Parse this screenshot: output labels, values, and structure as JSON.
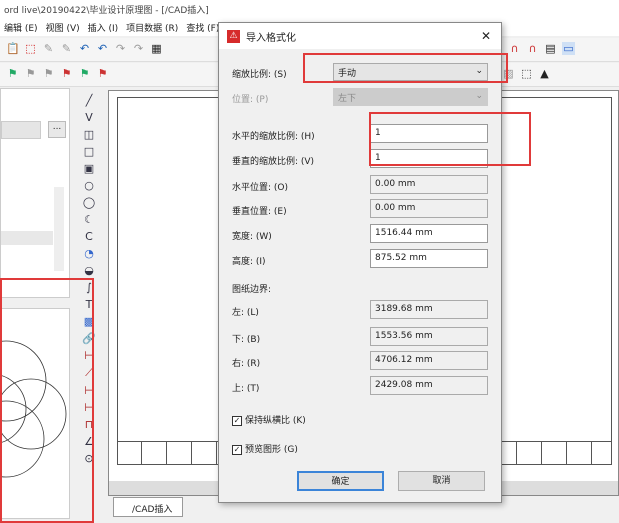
{
  "window": {
    "title": "ord live\\20190422\\毕业设计原理图 - [/CAD插入]"
  },
  "menu": [
    "编辑 (E)",
    "视图 (V)",
    "插入 (I)",
    "项目数据 (R)",
    "查找 (F)"
  ],
  "tab": {
    "label": "/CAD插入"
  },
  "dialog": {
    "title": "导入格式化",
    "close": "✕",
    "scale_label": "缩放比例: (S)",
    "scale_value": "手动",
    "position_label": "位置: (P)",
    "position_value": "左下",
    "hscale_label": "水平的缩放比例: (H)",
    "hscale_value": "1",
    "vscale_label": "垂直的缩放比例: (V)",
    "vscale_value": "1",
    "hpos_label": "水平位置: (O)",
    "hpos_value": "0.00 mm",
    "vpos_label": "垂直位置: (E)",
    "vpos_value": "0.00 mm",
    "width_label": "宽度: (W)",
    "width_value": "1516.44 mm",
    "height_label": "高度: (I)",
    "height_value": "875.52 mm",
    "border_heading": "图纸边界:",
    "left_label": "左: (L)",
    "left_value": "3189.68 mm",
    "bottom_label": "下: (B)",
    "bottom_value": "1553.56 mm",
    "right_label": "右: (R)",
    "right_value": "4706.12 mm",
    "top_label": "上: (T)",
    "top_value": "2429.08 mm",
    "keep_ratio_label": "保持纵横比 (K)",
    "keep_ratio_checked": true,
    "preview_label": "预览图形 (G)",
    "preview_checked": true,
    "ok": "确定",
    "cancel": "取消"
  },
  "left_panel": {
    "browse_button": "..."
  }
}
